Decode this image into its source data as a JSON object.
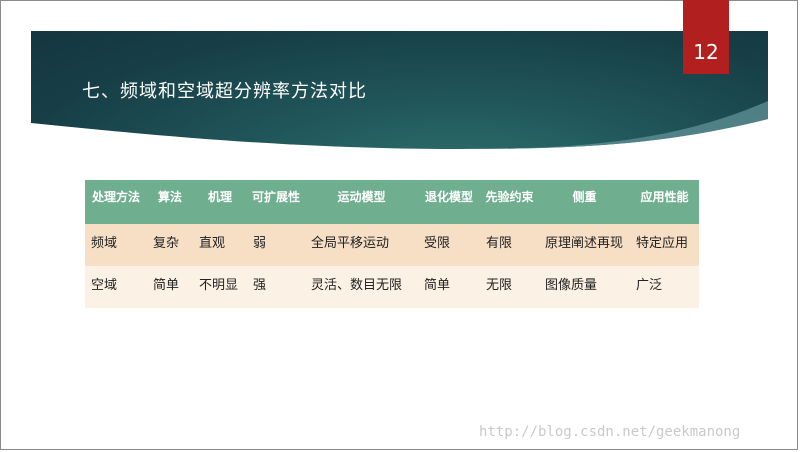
{
  "slide": {
    "title": "七、频域和空域超分辨率方法对比",
    "page_number": "12"
  },
  "table": {
    "headers": [
      "处理方法",
      "算法",
      "机理",
      "可扩展性",
      "运动模型",
      "退化模型",
      "先验约束",
      "侧重",
      "应用性能"
    ],
    "rows": [
      [
        "频域",
        "复杂",
        "直观",
        "弱",
        "全局平移运动",
        "受限",
        "有限",
        "原理阐述再现",
        "特定应用"
      ],
      [
        "空域",
        "简单",
        "不明显",
        "强",
        "灵活、数目无限",
        "简单",
        "无限",
        "图像质量",
        "广泛"
      ]
    ]
  },
  "watermark": "http://blog.csdn.net/geekmanong",
  "colors": {
    "banner": "#1f5458",
    "page_tab": "#b21f1f",
    "header_row": "#6fae8e",
    "row_1": "#f7dfc5",
    "row_2": "#fbf1e4"
  }
}
